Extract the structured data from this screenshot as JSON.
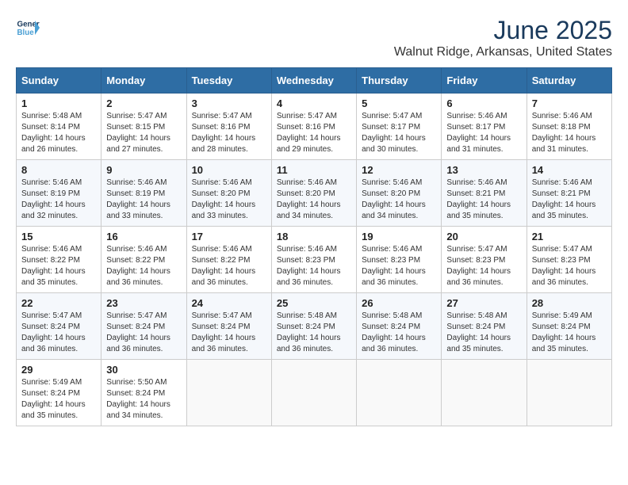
{
  "header": {
    "logo_line1": "General",
    "logo_line2": "Blue",
    "title": "June 2025",
    "subtitle": "Walnut Ridge, Arkansas, United States"
  },
  "calendar": {
    "headers": [
      "Sunday",
      "Monday",
      "Tuesday",
      "Wednesday",
      "Thursday",
      "Friday",
      "Saturday"
    ],
    "weeks": [
      [
        {
          "day": "",
          "info": ""
        },
        {
          "day": "2",
          "info": "Sunrise: 5:47 AM\nSunset: 8:15 PM\nDaylight: 14 hours\nand 27 minutes."
        },
        {
          "day": "3",
          "info": "Sunrise: 5:47 AM\nSunset: 8:16 PM\nDaylight: 14 hours\nand 28 minutes."
        },
        {
          "day": "4",
          "info": "Sunrise: 5:47 AM\nSunset: 8:16 PM\nDaylight: 14 hours\nand 29 minutes."
        },
        {
          "day": "5",
          "info": "Sunrise: 5:47 AM\nSunset: 8:17 PM\nDaylight: 14 hours\nand 30 minutes."
        },
        {
          "day": "6",
          "info": "Sunrise: 5:46 AM\nSunset: 8:17 PM\nDaylight: 14 hours\nand 31 minutes."
        },
        {
          "day": "7",
          "info": "Sunrise: 5:46 AM\nSunset: 8:18 PM\nDaylight: 14 hours\nand 31 minutes."
        }
      ],
      [
        {
          "day": "8",
          "info": "Sunrise: 5:46 AM\nSunset: 8:19 PM\nDaylight: 14 hours\nand 32 minutes."
        },
        {
          "day": "9",
          "info": "Sunrise: 5:46 AM\nSunset: 8:19 PM\nDaylight: 14 hours\nand 33 minutes."
        },
        {
          "day": "10",
          "info": "Sunrise: 5:46 AM\nSunset: 8:20 PM\nDaylight: 14 hours\nand 33 minutes."
        },
        {
          "day": "11",
          "info": "Sunrise: 5:46 AM\nSunset: 8:20 PM\nDaylight: 14 hours\nand 34 minutes."
        },
        {
          "day": "12",
          "info": "Sunrise: 5:46 AM\nSunset: 8:20 PM\nDaylight: 14 hours\nand 34 minutes."
        },
        {
          "day": "13",
          "info": "Sunrise: 5:46 AM\nSunset: 8:21 PM\nDaylight: 14 hours\nand 35 minutes."
        },
        {
          "day": "14",
          "info": "Sunrise: 5:46 AM\nSunset: 8:21 PM\nDaylight: 14 hours\nand 35 minutes."
        }
      ],
      [
        {
          "day": "15",
          "info": "Sunrise: 5:46 AM\nSunset: 8:22 PM\nDaylight: 14 hours\nand 35 minutes."
        },
        {
          "day": "16",
          "info": "Sunrise: 5:46 AM\nSunset: 8:22 PM\nDaylight: 14 hours\nand 36 minutes."
        },
        {
          "day": "17",
          "info": "Sunrise: 5:46 AM\nSunset: 8:22 PM\nDaylight: 14 hours\nand 36 minutes."
        },
        {
          "day": "18",
          "info": "Sunrise: 5:46 AM\nSunset: 8:23 PM\nDaylight: 14 hours\nand 36 minutes."
        },
        {
          "day": "19",
          "info": "Sunrise: 5:46 AM\nSunset: 8:23 PM\nDaylight: 14 hours\nand 36 minutes."
        },
        {
          "day": "20",
          "info": "Sunrise: 5:47 AM\nSunset: 8:23 PM\nDaylight: 14 hours\nand 36 minutes."
        },
        {
          "day": "21",
          "info": "Sunrise: 5:47 AM\nSunset: 8:23 PM\nDaylight: 14 hours\nand 36 minutes."
        }
      ],
      [
        {
          "day": "22",
          "info": "Sunrise: 5:47 AM\nSunset: 8:24 PM\nDaylight: 14 hours\nand 36 minutes."
        },
        {
          "day": "23",
          "info": "Sunrise: 5:47 AM\nSunset: 8:24 PM\nDaylight: 14 hours\nand 36 minutes."
        },
        {
          "day": "24",
          "info": "Sunrise: 5:47 AM\nSunset: 8:24 PM\nDaylight: 14 hours\nand 36 minutes."
        },
        {
          "day": "25",
          "info": "Sunrise: 5:48 AM\nSunset: 8:24 PM\nDaylight: 14 hours\nand 36 minutes."
        },
        {
          "day": "26",
          "info": "Sunrise: 5:48 AM\nSunset: 8:24 PM\nDaylight: 14 hours\nand 36 minutes."
        },
        {
          "day": "27",
          "info": "Sunrise: 5:48 AM\nSunset: 8:24 PM\nDaylight: 14 hours\nand 35 minutes."
        },
        {
          "day": "28",
          "info": "Sunrise: 5:49 AM\nSunset: 8:24 PM\nDaylight: 14 hours\nand 35 minutes."
        }
      ],
      [
        {
          "day": "29",
          "info": "Sunrise: 5:49 AM\nSunset: 8:24 PM\nDaylight: 14 hours\nand 35 minutes."
        },
        {
          "day": "30",
          "info": "Sunrise: 5:50 AM\nSunset: 8:24 PM\nDaylight: 14 hours\nand 34 minutes."
        },
        {
          "day": "",
          "info": ""
        },
        {
          "day": "",
          "info": ""
        },
        {
          "day": "",
          "info": ""
        },
        {
          "day": "",
          "info": ""
        },
        {
          "day": "",
          "info": ""
        }
      ]
    ],
    "week1_day1": {
      "day": "1",
      "info": "Sunrise: 5:48 AM\nSunset: 8:14 PM\nDaylight: 14 hours\nand 26 minutes."
    }
  }
}
